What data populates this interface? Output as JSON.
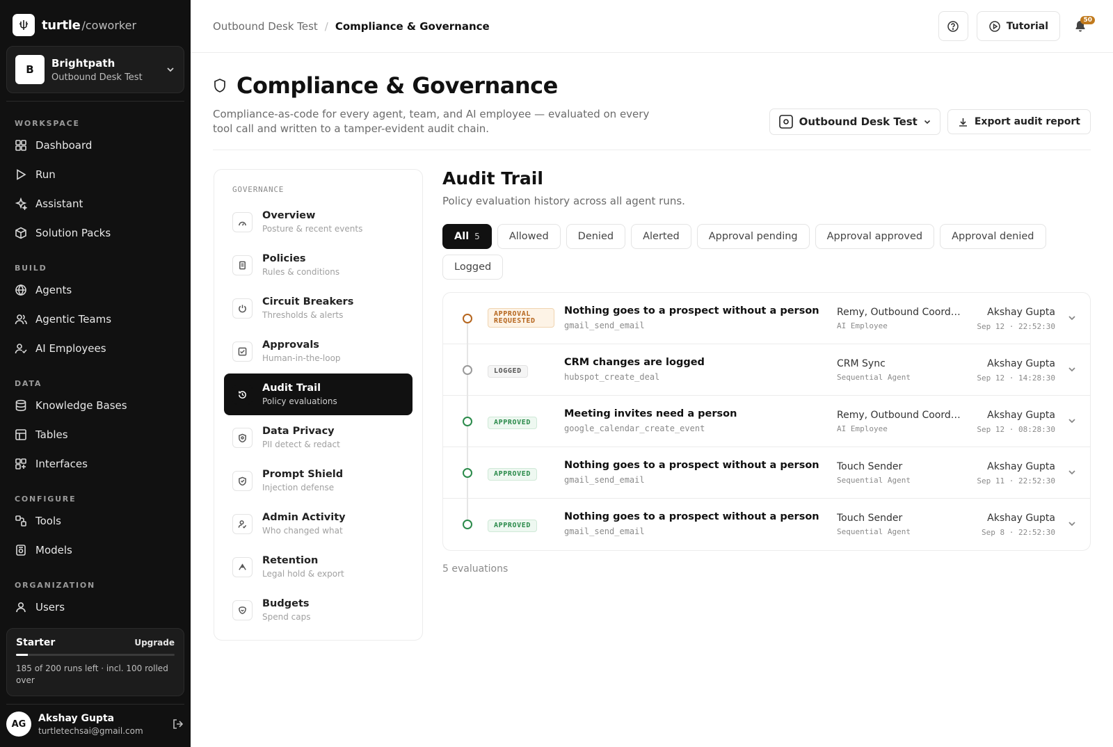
{
  "brand": {
    "name": "turtle",
    "sub": "/coworker"
  },
  "workspace": {
    "avatar": "B",
    "name": "Brightpath",
    "sub": "Outbound Desk Test"
  },
  "nav": {
    "sections": [
      {
        "label": "WORKSPACE",
        "items": [
          {
            "label": "Dashboard",
            "icon": "dashboard-icon"
          },
          {
            "label": "Run",
            "icon": "play-icon"
          },
          {
            "label": "Assistant",
            "icon": "sparkle-icon"
          },
          {
            "label": "Solution Packs",
            "icon": "package-icon"
          }
        ]
      },
      {
        "label": "BUILD",
        "items": [
          {
            "label": "Agents",
            "icon": "globe-icon"
          },
          {
            "label": "Agentic Teams",
            "icon": "users-icon"
          },
          {
            "label": "AI Employees",
            "icon": "user-check-icon"
          }
        ]
      },
      {
        "label": "DATA",
        "items": [
          {
            "label": "Knowledge Bases",
            "icon": "database-icon"
          },
          {
            "label": "Tables",
            "icon": "table-icon"
          },
          {
            "label": "Interfaces",
            "icon": "layout-icon"
          }
        ]
      },
      {
        "label": "CONFIGURE",
        "items": [
          {
            "label": "Tools",
            "icon": "tools-icon"
          },
          {
            "label": "Models",
            "icon": "model-icon"
          }
        ]
      },
      {
        "label": "ORGANIZATION",
        "items": [
          {
            "label": "Users",
            "icon": "user-icon"
          }
        ]
      }
    ]
  },
  "plan": {
    "name": "Starter",
    "upgrade": "Upgrade",
    "usage_fraction": 0.075,
    "text": "185 of 200 runs left · incl. 100 rolled over"
  },
  "user": {
    "initials": "AG",
    "name": "Akshay Gupta",
    "email": "turtletechsai@gmail.com"
  },
  "topbar": {
    "crumb_parent": "Outbound Desk Test",
    "crumb_current": "Compliance & Governance",
    "tutorial": "Tutorial",
    "notifications": "50"
  },
  "page": {
    "title": "Compliance & Governance",
    "description": "Compliance-as-code for every agent, team, and AI employee — evaluated on every tool call and written to a tamper-evident audit chain.",
    "workspace_select": "Outbound Desk Test",
    "export": "Export audit report"
  },
  "governance": {
    "label": "GOVERNANCE",
    "items": [
      {
        "name": "Overview",
        "sub": "Posture & recent events",
        "icon": "gauge-icon",
        "active": false
      },
      {
        "name": "Policies",
        "sub": "Rules & conditions",
        "icon": "document-icon",
        "active": false
      },
      {
        "name": "Circuit Breakers",
        "sub": "Thresholds & alerts",
        "icon": "power-icon",
        "active": false
      },
      {
        "name": "Approvals",
        "sub": "Human-in-the-loop",
        "icon": "checkbox-icon",
        "active": false
      },
      {
        "name": "Audit Trail",
        "sub": "Policy evaluations",
        "icon": "history-icon",
        "active": true
      },
      {
        "name": "Data Privacy",
        "sub": "PII detect & redact",
        "icon": "shield-lock-icon",
        "active": false
      },
      {
        "name": "Prompt Shield",
        "sub": "Injection defense",
        "icon": "shield-icon",
        "active": false
      },
      {
        "name": "Admin Activity",
        "sub": "Who changed what",
        "icon": "user-activity-icon",
        "active": false
      },
      {
        "name": "Retention",
        "sub": "Legal hold & export",
        "icon": "archive-icon",
        "active": false
      },
      {
        "name": "Budgets",
        "sub": "Spend caps",
        "icon": "wallet-icon",
        "active": false
      }
    ]
  },
  "audit": {
    "title": "Audit Trail",
    "subtitle": "Policy evaluation history across all agent runs.",
    "filters": [
      {
        "label": "All",
        "count": "5",
        "active": true
      },
      {
        "label": "Allowed"
      },
      {
        "label": "Denied"
      },
      {
        "label": "Alerted"
      },
      {
        "label": "Approval pending"
      },
      {
        "label": "Approval approved"
      },
      {
        "label": "Approval denied"
      },
      {
        "label": "Logged"
      }
    ],
    "rows": [
      {
        "status": "APPROVAL REQUESTED",
        "kind": "requested",
        "title": "Nothing goes to a prospect without a person",
        "tool": "gmail_send_email",
        "agent": "Remy, Outbound Coordinator",
        "agent_type": "AI Employee",
        "who": "Akshay Gupta",
        "time": "Sep 12 · 22:52:30"
      },
      {
        "status": "LOGGED",
        "kind": "logged",
        "title": "CRM changes are logged",
        "tool": "hubspot_create_deal",
        "agent": "CRM Sync",
        "agent_type": "Sequential Agent",
        "who": "Akshay Gupta",
        "time": "Sep 12 · 14:28:30"
      },
      {
        "status": "APPROVED",
        "kind": "approved",
        "title": "Meeting invites need a person",
        "tool": "google_calendar_create_event",
        "agent": "Remy, Outbound Coordinator",
        "agent_type": "AI Employee",
        "who": "Akshay Gupta",
        "time": "Sep 12 · 08:28:30"
      },
      {
        "status": "APPROVED",
        "kind": "approved",
        "title": "Nothing goes to a prospect without a person",
        "tool": "gmail_send_email",
        "agent": "Touch Sender",
        "agent_type": "Sequential Agent",
        "who": "Akshay Gupta",
        "time": "Sep 11 · 22:52:30"
      },
      {
        "status": "APPROVED",
        "kind": "approved",
        "title": "Nothing goes to a prospect without a person",
        "tool": "gmail_send_email",
        "agent": "Touch Sender",
        "agent_type": "Sequential Agent",
        "who": "Akshay Gupta",
        "time": "Sep 8 · 22:52:30"
      }
    ],
    "count_note": "5 evaluations"
  },
  "colors": {
    "sidebar": "#111111",
    "accent": "#111111",
    "approved": "#2a8a4a",
    "requested": "#b5651d",
    "badge": "#c17a1d"
  }
}
